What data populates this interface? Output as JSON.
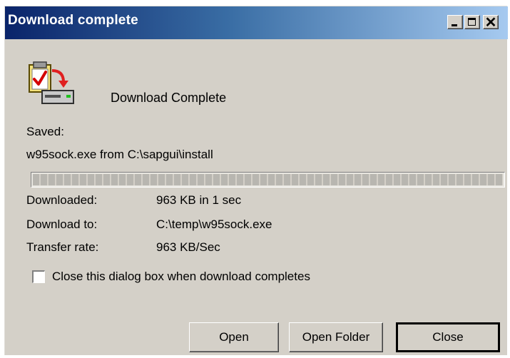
{
  "window": {
    "title": "Download complete",
    "minimize_icon": "minimize-icon",
    "maximize_icon": "maximize-icon",
    "close_icon": "close-icon",
    "close_glyph": "✕"
  },
  "header": {
    "icon": "download-complete-icon",
    "heading": "Download Complete"
  },
  "saved": {
    "label": "Saved:",
    "detail": "w95sock.exe from C:\\sapgui\\install"
  },
  "progress": {
    "value_percent": 100
  },
  "details": {
    "downloaded_label": "Downloaded:",
    "downloaded_value": "963 KB in 1 sec",
    "download_to_label": "Download to:",
    "download_to_value": "C:\\temp\\w95sock.exe",
    "transfer_rate_label": "Transfer rate:",
    "transfer_rate_value": "963 KB/Sec"
  },
  "option": {
    "checkbox_label": "Close this dialog box when download completes",
    "checked": false
  },
  "buttons": {
    "open": "Open",
    "open_folder": "Open Folder",
    "close": "Close"
  },
  "colors": {
    "titlebar_start": "#0a246a",
    "titlebar_end": "#a6caf0",
    "dialog_face": "#d4d0c8"
  }
}
